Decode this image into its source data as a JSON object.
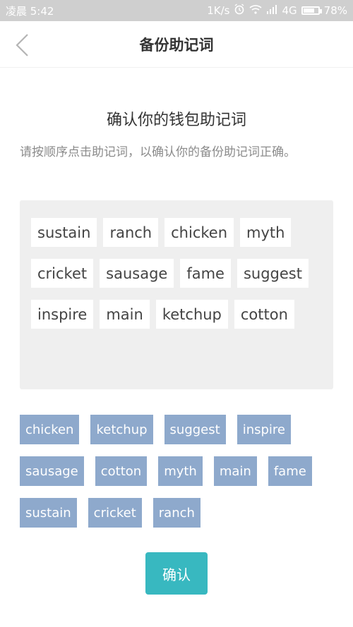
{
  "status_bar": {
    "time": "凌晨 5:42",
    "network_speed": "1K/s",
    "network_type": "4G",
    "battery": "78%",
    "battery_level": 0.78
  },
  "nav": {
    "title": "备份助记词",
    "back_icon": "chevron-left-icon"
  },
  "page": {
    "heading": "确认你的钱包助记词",
    "instruction": "请按顺序点击助记词，以确认你的备份助记词正确。"
  },
  "selected_words": [
    "sustain",
    "ranch",
    "chicken",
    "myth",
    "cricket",
    "sausage",
    "fame",
    "suggest",
    "inspire",
    "main",
    "ketchup",
    "cotton"
  ],
  "word_options": [
    "chicken",
    "ketchup",
    "suggest",
    "inspire",
    "sausage",
    "cotton",
    "myth",
    "main",
    "fame",
    "sustain",
    "cricket",
    "ranch"
  ],
  "confirm_label": "确认",
  "colors": {
    "status_bar": "#cfcfcf",
    "chip_option": "#8ea9cc",
    "selected_area": "#efefef",
    "confirm_button": "#38b8c0"
  }
}
